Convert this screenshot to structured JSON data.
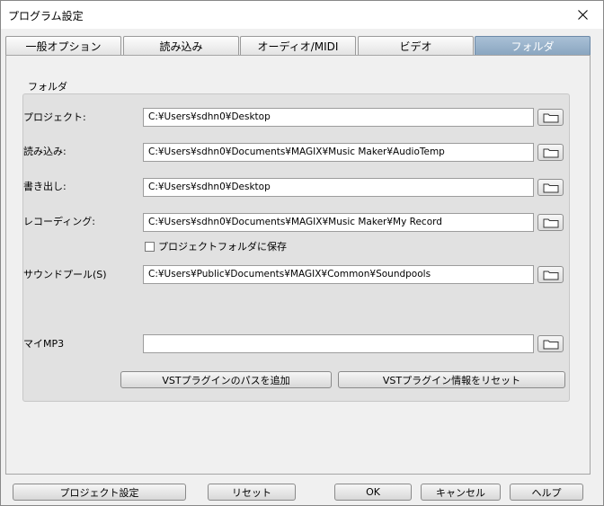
{
  "window": {
    "title": "プログラム設定"
  },
  "tabs": [
    {
      "label": "一般オプション"
    },
    {
      "label": "読み込み"
    },
    {
      "label": "オーディオ/MIDI"
    },
    {
      "label": "ビデオ"
    },
    {
      "label": "フォルダ",
      "active": true
    }
  ],
  "group": {
    "label": "フォルダ"
  },
  "folders": {
    "project": {
      "label": "プロジェクト:",
      "value": "C:¥Users¥sdhn0¥Desktop"
    },
    "import": {
      "label": "読み込み:",
      "value": "C:¥Users¥sdhn0¥Documents¥MAGIX¥Music Maker¥AudioTemp"
    },
    "export": {
      "label": "書き出し:",
      "value": "C:¥Users¥sdhn0¥Desktop"
    },
    "recording": {
      "label": "レコーディング:",
      "value": "C:¥Users¥sdhn0¥Documents¥MAGIX¥Music Maker¥My Record"
    },
    "soundpool": {
      "label": "サウンドプール(S)",
      "value": "C:¥Users¥Public¥Documents¥MAGIX¥Common¥Soundpools"
    },
    "mymp3": {
      "label": "マイMP3",
      "value": ""
    }
  },
  "checkbox": {
    "label": "プロジェクトフォルダに保存",
    "checked": false
  },
  "vst": {
    "add_path": "VSTプラグインのパスを追加",
    "reset_info": "VSTプラグイン情報をリセット"
  },
  "footer": {
    "project_settings": "プロジェクト設定",
    "reset": "リセット",
    "ok": "OK",
    "cancel": "キャンセル",
    "help": "ヘルプ"
  },
  "icons": {
    "close": "close-icon",
    "folder": "folder-icon"
  },
  "colors": {
    "active_tab": "#8aa6c0",
    "group_bg": "#e1e1e1",
    "window_bg": "#f0f0f0"
  }
}
